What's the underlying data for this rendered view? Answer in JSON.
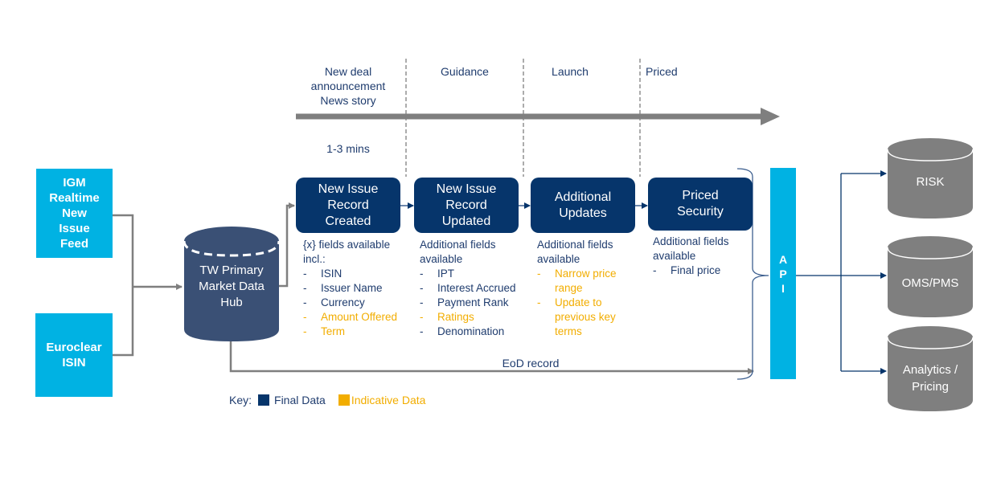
{
  "sources": [
    {
      "label": "IGM\nRealtime\nNew\nIssue\nFeed"
    },
    {
      "label": "Euroclear\nISIN"
    }
  ],
  "hub": {
    "label": "TW Primary\nMarket Data\nHub"
  },
  "timeline": {
    "stages": [
      "New deal\nannouncement\nNews story",
      "Guidance",
      "Launch",
      "Priced"
    ],
    "latency": "1-3 mins"
  },
  "steps": [
    {
      "title": "New Issue\nRecord\nCreated",
      "intro": "{x} fields available incl.:",
      "items": [
        {
          "text": "ISIN",
          "type": "final"
        },
        {
          "text": "Issuer Name",
          "type": "final"
        },
        {
          "text": "Currency",
          "type": "final"
        },
        {
          "text": "Amount Offered",
          "type": "indicative"
        },
        {
          "text": "Term",
          "type": "indicative"
        }
      ]
    },
    {
      "title": "New Issue\nRecord\nUpdated",
      "intro": "Additional fields available",
      "items": [
        {
          "text": "IPT",
          "type": "final"
        },
        {
          "text": "Interest Accrued",
          "type": "final"
        },
        {
          "text": "Payment Rank",
          "type": "final"
        },
        {
          "text": "Ratings",
          "type": "indicative"
        },
        {
          "text": "Denomination",
          "type": "final"
        }
      ]
    },
    {
      "title": "Additional\nUpdates",
      "intro": "Additional fields available",
      "items": [
        {
          "text": "Narrow price range",
          "type": "indicative"
        },
        {
          "text": "Update to previous key terms",
          "type": "indicative"
        }
      ]
    },
    {
      "title": "Priced\nSecurity",
      "intro": "Additional fields available",
      "items": [
        {
          "text": "Final price",
          "type": "final"
        }
      ]
    }
  ],
  "eod_label": "EoD record",
  "api": {
    "letters": [
      "A",
      "P",
      "I"
    ]
  },
  "targets": [
    {
      "label": "RISK"
    },
    {
      "label": "OMS/PMS"
    },
    {
      "label": "Analytics /\nPricing"
    }
  ],
  "key": {
    "label": "Key:",
    "final_label": "Final Data",
    "indicative_label": "Indicative Data",
    "final_color": "#06356b",
    "indicative_color": "#f2ad00"
  }
}
